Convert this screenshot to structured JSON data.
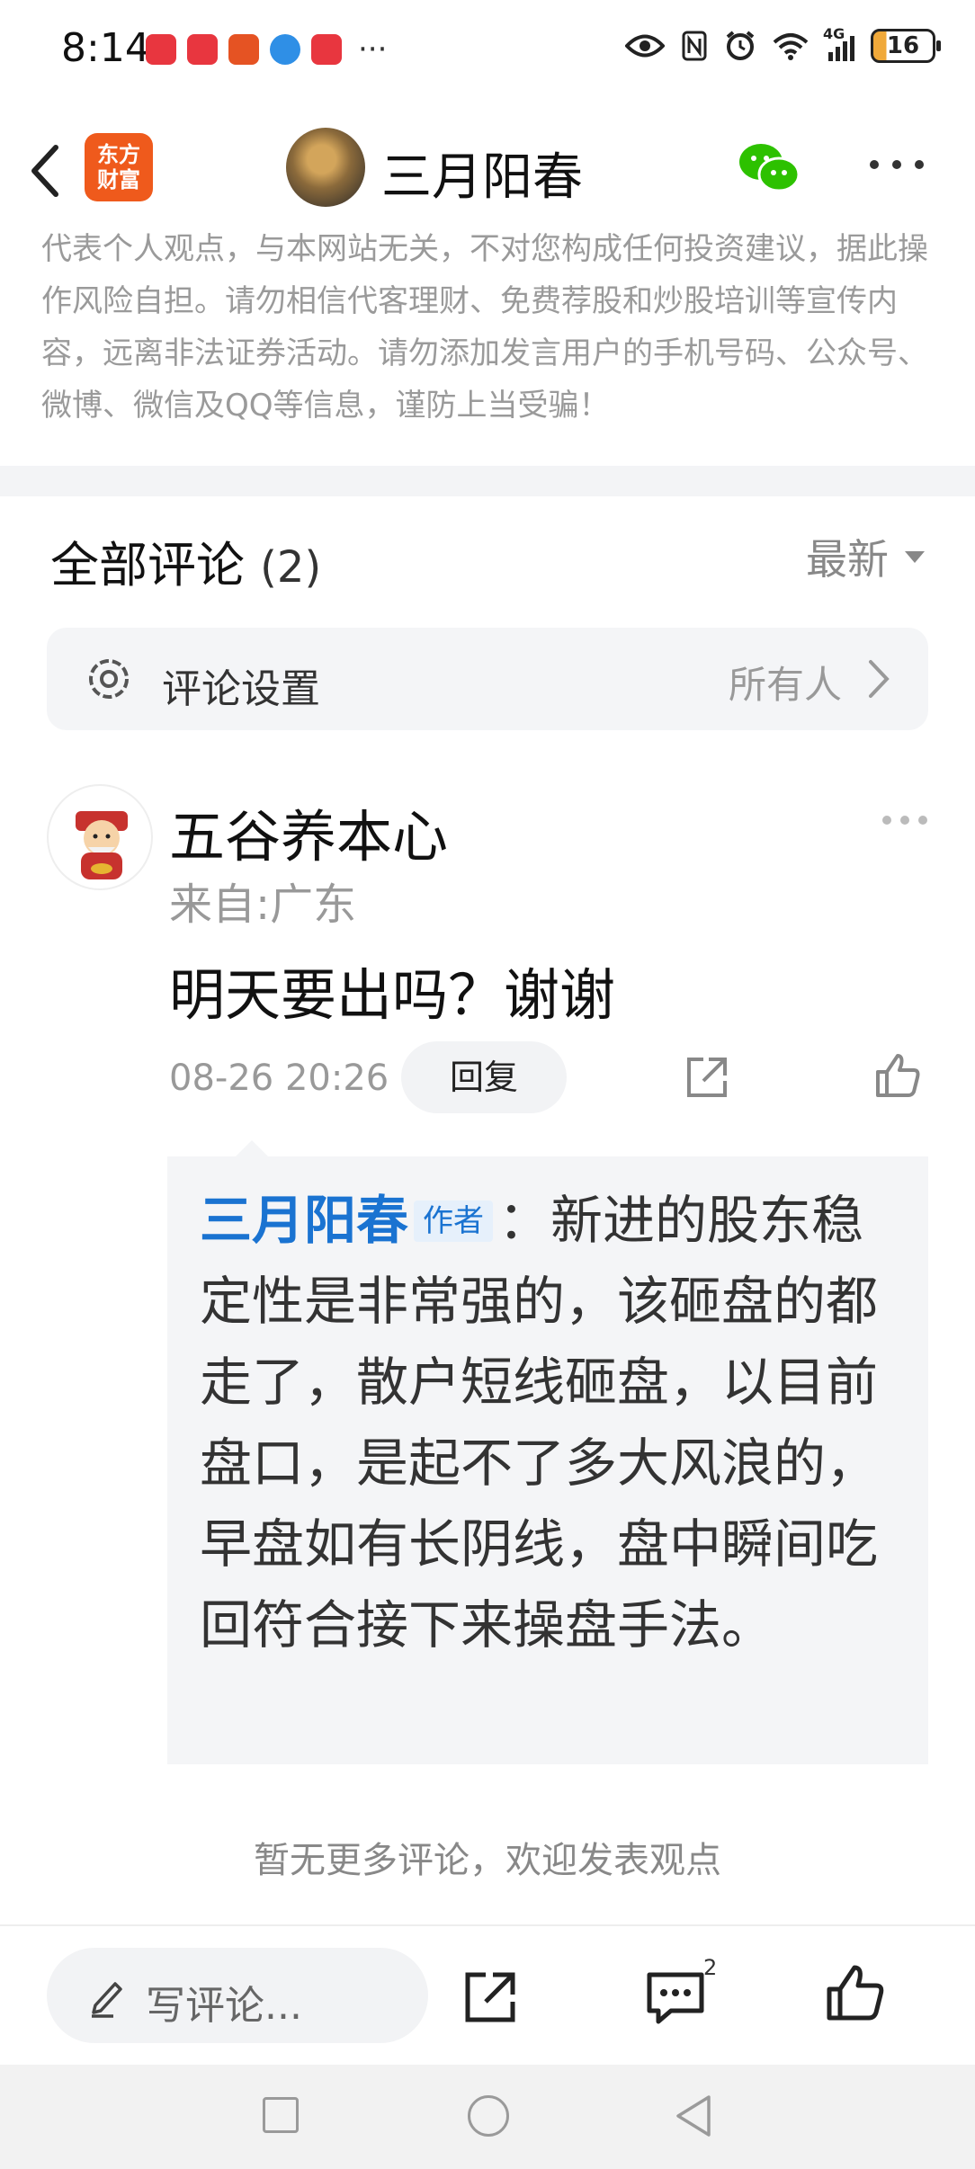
{
  "status_bar": {
    "time": "8:14",
    "dots": "···",
    "network": "4G",
    "battery": "16"
  },
  "header": {
    "logo_line1": "东方",
    "logo_line2": "财富",
    "title": "三月阳春"
  },
  "disclaimer": "代表个人观点，与本网站无关，不对您构成任何投资建议，据此操作风险自担。请勿相信代客理财、免费荐股和炒股培训等宣传内容，远离非法证券活动。请勿添加发言用户的手机号码、公众号、微博、微信及QQ等信息，谨防上当受骗！",
  "comments_header": {
    "title": "全部评论",
    "count": "(2)",
    "sort_label": "最新"
  },
  "settings": {
    "label": "评论设置",
    "value": "所有人"
  },
  "comment": {
    "user": "五谷养本心",
    "location": "来自:广东",
    "text": "明天要出吗？谢谢",
    "time": "08-26 20:26",
    "reply_label": "回复",
    "reply": {
      "author": "三月阳春",
      "author_tag": "作者",
      "text": "：新进的股东稳定性是非常强的，该砸盘的都走了，散户短线砸盘，以目前盘口，是起不了多大风浪的，早盘如有长阴线，盘中瞬间吃回符合接下来操盘手法。"
    }
  },
  "no_more": "暂无更多评论，欢迎发表观点",
  "bottom_bar": {
    "write_placeholder": "写评论...",
    "comment_count": "2"
  },
  "colors": {
    "brand_orange": "#ef5a1c",
    "link_blue": "#1a73d1",
    "wechat_green": "#2dc100"
  }
}
